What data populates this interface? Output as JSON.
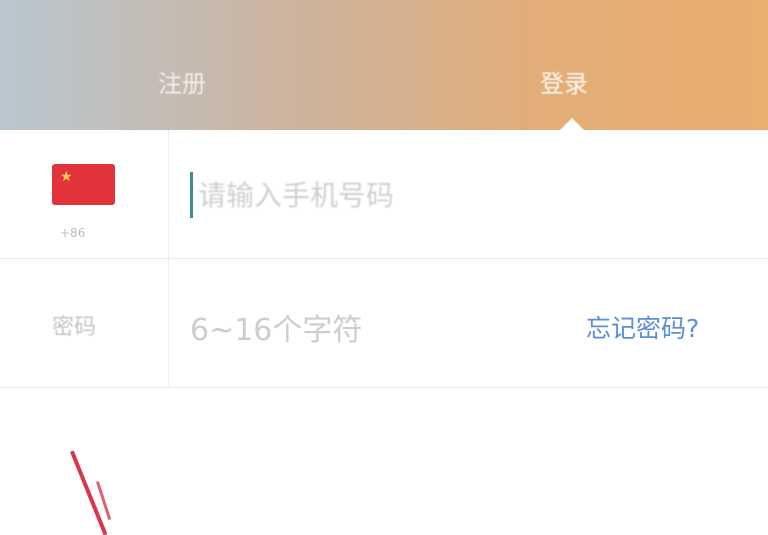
{
  "tabs": {
    "register_label": "注册",
    "login_label": "登录"
  },
  "phone_row": {
    "flag_icon": "china-flag-icon",
    "country_code": "+86",
    "placeholder": "请输入手机号码"
  },
  "password_row": {
    "label": "密码",
    "placeholder": "6~16个字符",
    "forgot_label": "忘记密码?"
  },
  "colors": {
    "header_start": "#b9c6cf",
    "header_end": "#eaae6e",
    "link": "#5b8ed8",
    "cursor": "#3d8d98",
    "flag": "#e2333a"
  }
}
